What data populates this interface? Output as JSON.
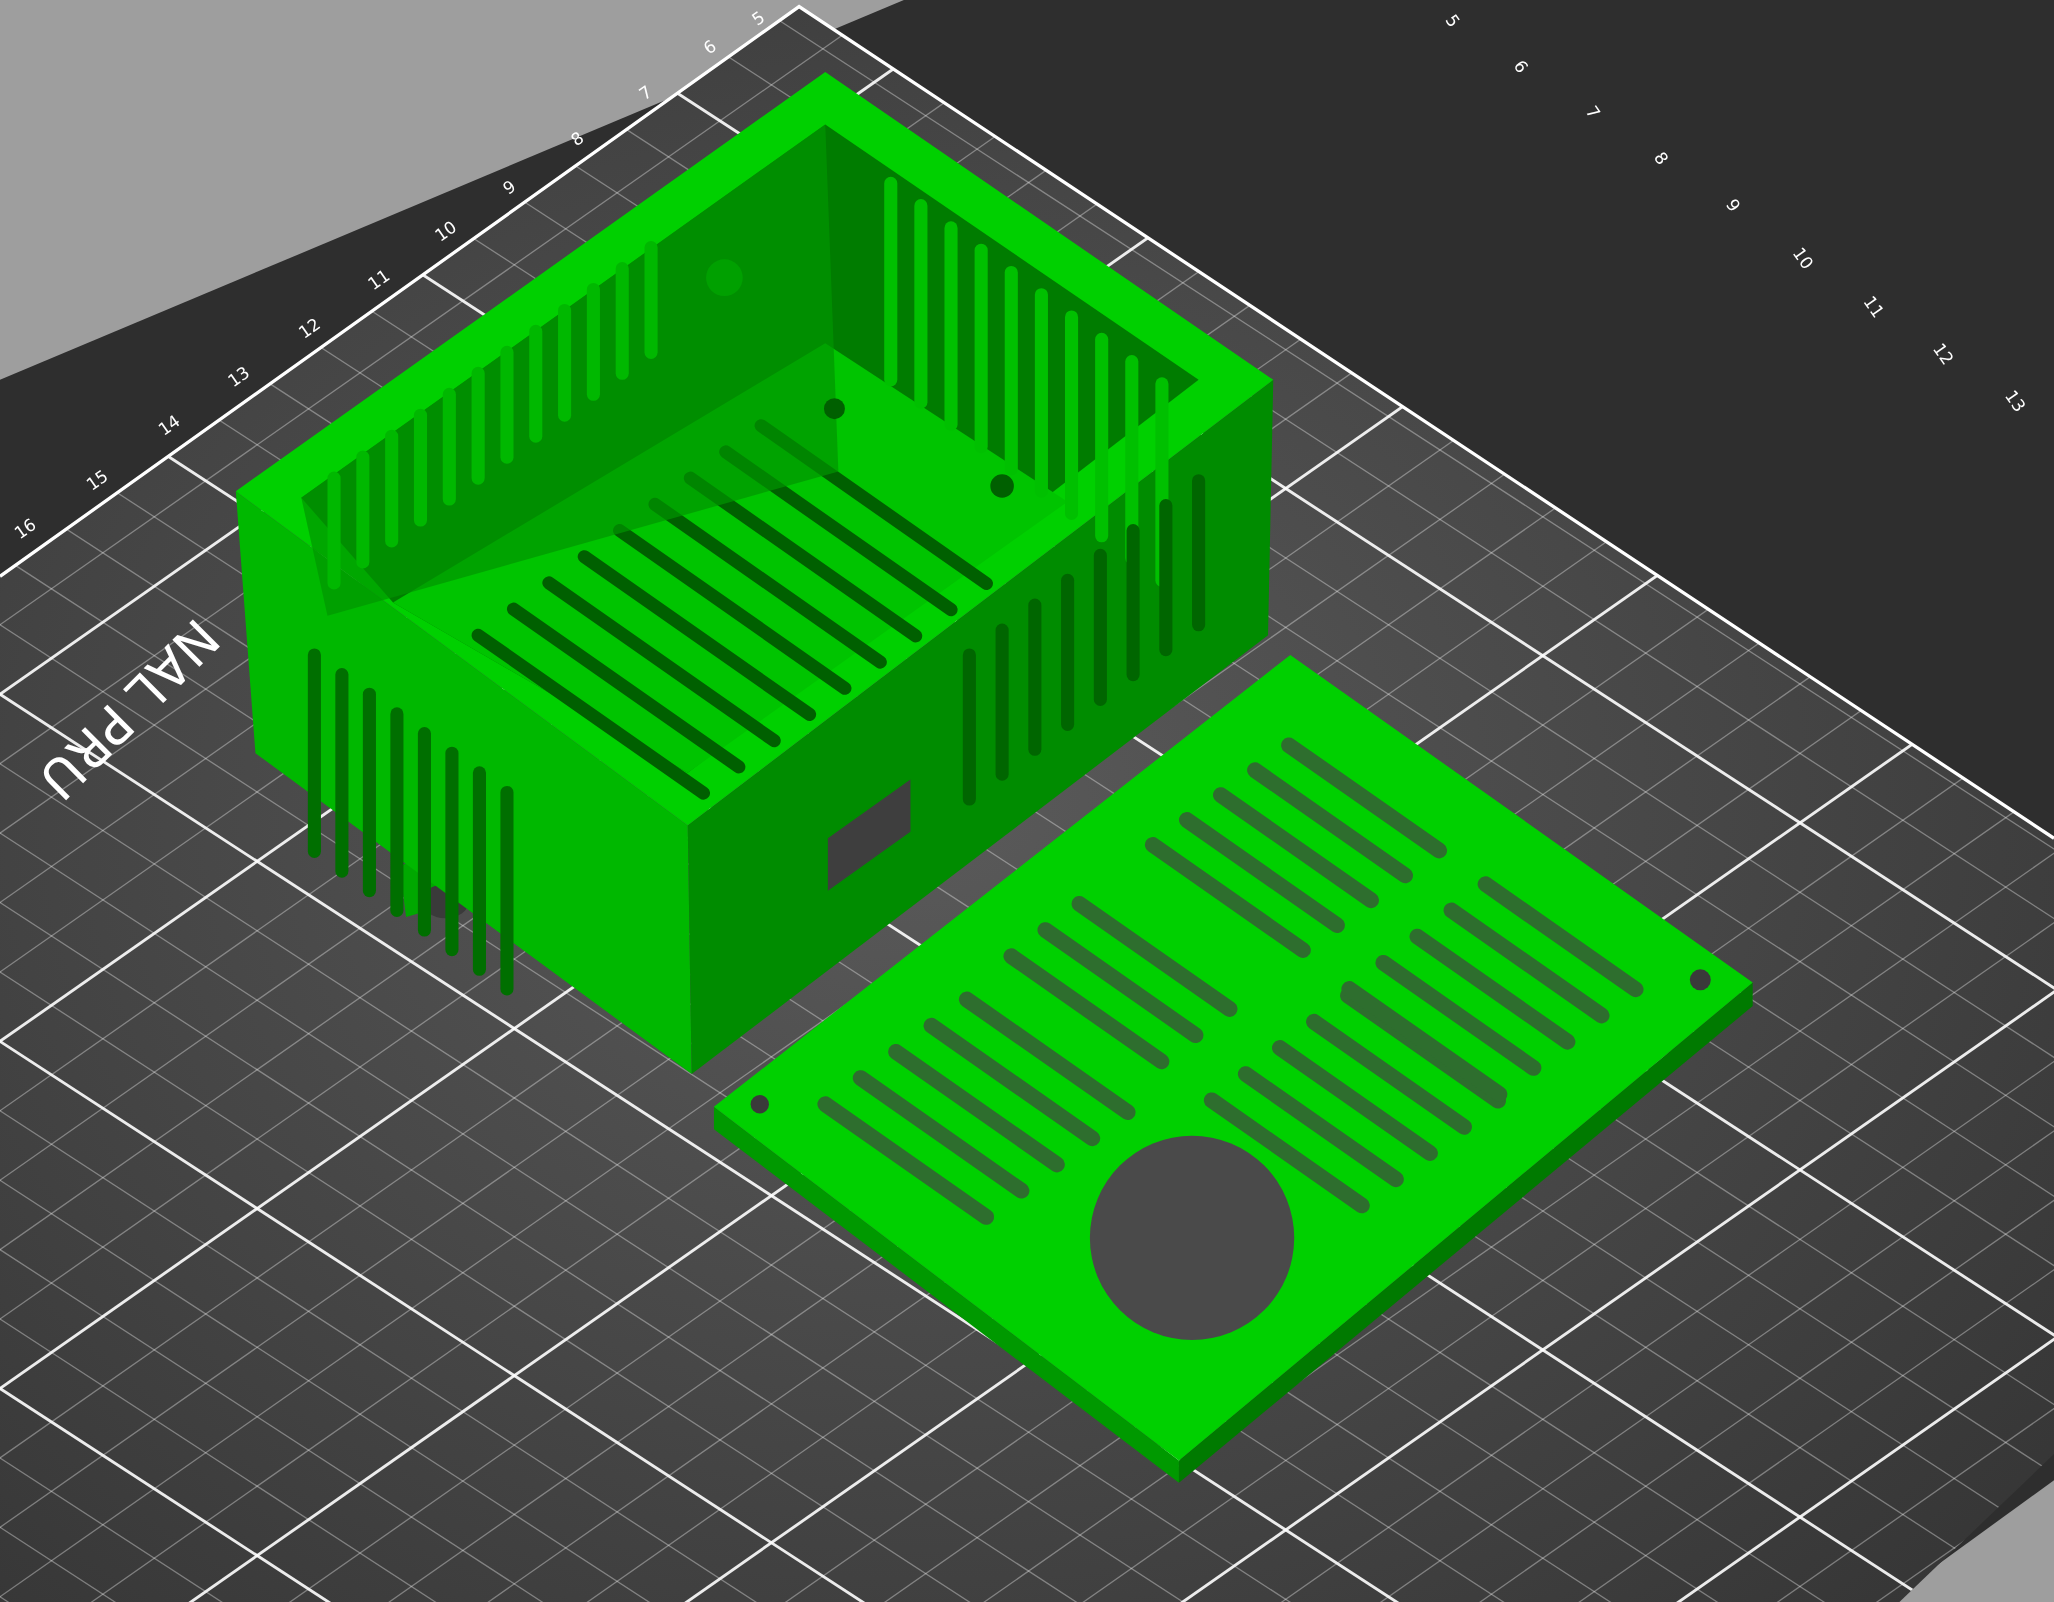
{
  "bed": {
    "left_ruler": [
      "5",
      "6",
      "7",
      "8",
      "9",
      "10",
      "11",
      "12",
      "13",
      "14",
      "15",
      "16"
    ],
    "right_ruler": [
      "5",
      "6",
      "7",
      "8",
      "9",
      "10",
      "11",
      "12",
      "13"
    ],
    "logo_text": "NAL PRU"
  }
}
